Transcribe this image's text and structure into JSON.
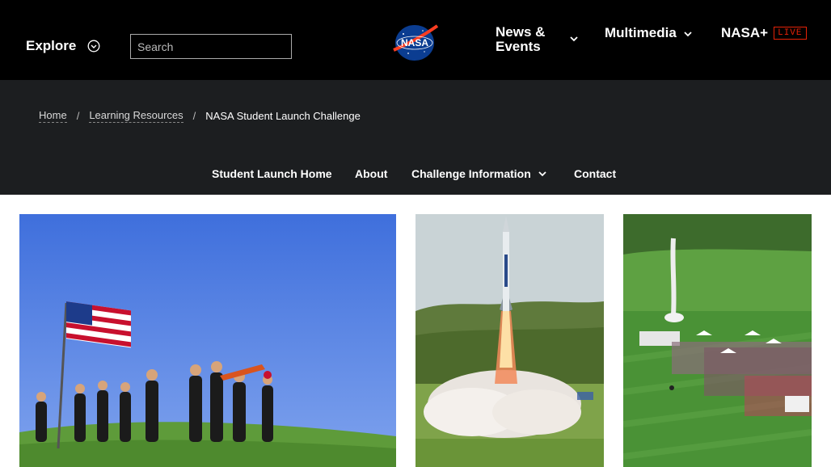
{
  "header": {
    "explore_label": "Explore",
    "search_placeholder": "Search",
    "logo_text": "NASA",
    "nav": {
      "news_events_line1": "News &",
      "news_events_line2": "Events",
      "multimedia": "Multimedia",
      "nasa_plus": "NASA+",
      "live_badge": "LIVE"
    }
  },
  "breadcrumb": {
    "home": "Home",
    "separator": "/",
    "learning_resources": "Learning Resources",
    "current": "NASA Student Launch Challenge"
  },
  "subnav": {
    "home": "Student Launch Home",
    "about": "About",
    "challenge_info": "Challenge Information",
    "contact": "Contact"
  },
  "colors": {
    "header_bg": "#000000",
    "subbar_bg": "#1c1e20",
    "live_red": "#e52207",
    "nasa_blue": "#0b3d91"
  },
  "icons": {
    "explore": "chevron-circle-down-icon",
    "dropdown": "chevron-down-icon"
  }
}
